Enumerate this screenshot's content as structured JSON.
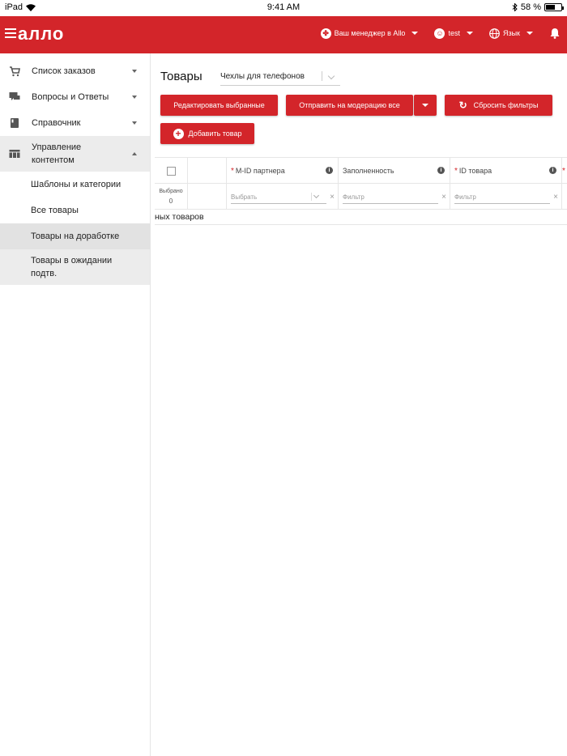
{
  "statusbar": {
    "device": "iPad",
    "time": "9:41 AM",
    "battery": "58 %"
  },
  "header": {
    "logo": "≡алло",
    "manager": "Ваш менеджер в Allo",
    "user": "test",
    "language": "Язык"
  },
  "sidebar": {
    "items": [
      {
        "label": "Список заказов"
      },
      {
        "label": "Вопросы и Ответы"
      },
      {
        "label": "Справочник"
      },
      {
        "label": "Управление контентом"
      }
    ],
    "subitems": [
      {
        "label": "Шаблоны и категории"
      },
      {
        "label": "Все товары"
      },
      {
        "label": "Товары на доработке"
      },
      {
        "label": "Товары в ожидании подтв."
      }
    ]
  },
  "main": {
    "title": "Товары",
    "category_select": "Чехлы для телефонов",
    "buttons": {
      "edit_selected": "Редактировать выбранные",
      "send_moderation": "Отправить на модерацию все",
      "reset_filters": "Сбросить фильтры",
      "add_product": "Добавить товар"
    },
    "table": {
      "columns": [
        "M-ID партнера",
        "Заполненность",
        "ID товара"
      ],
      "selected_label": "Выбрано",
      "selected_count": "0",
      "filter_placeholders": [
        "Выбрать",
        "Фильтр",
        "Фильтр"
      ],
      "empty_text": "ных товаров"
    }
  },
  "colors": {
    "brand_red": "#d3252a"
  }
}
